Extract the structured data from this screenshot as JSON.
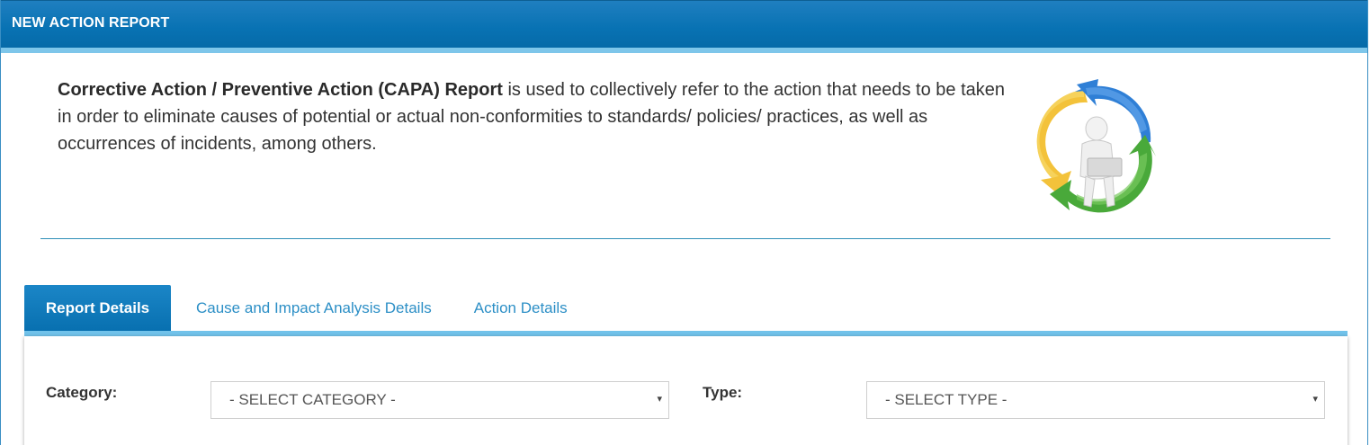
{
  "header": {
    "title": "NEW ACTION REPORT"
  },
  "intro": {
    "bold_text": "Corrective Action / Preventive Action (CAPA) Report",
    "rest_text": " is used to collectively refer to the action that needs to be taken in order to eliminate causes of potential or actual non-conformities to standards/ policies/ practices, as well as occurrences of incidents, among others."
  },
  "illustration": {
    "icon": "capa-cycle-person-laptop-icon"
  },
  "tabs": [
    {
      "label": "Report Details",
      "active": true
    },
    {
      "label": "Cause and Impact Analysis Details",
      "active": false
    },
    {
      "label": "Action Details",
      "active": false
    }
  ],
  "form": {
    "category_label": "Category:",
    "category_value": "- SELECT CATEGORY -",
    "type_label": "Type:",
    "type_value": "- SELECT TYPE -",
    "caret_icon": "▾"
  },
  "colors": {
    "header_blue": "#0872b3",
    "accent_light_blue": "#7ec6ea",
    "link_blue": "#2c8fc6"
  }
}
